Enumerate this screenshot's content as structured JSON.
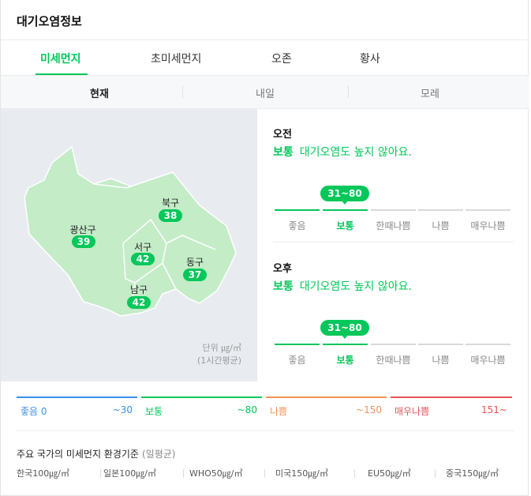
{
  "title": "대기오염정보",
  "tabs": [
    {
      "label": "미세먼지",
      "active": true
    },
    {
      "label": "초미세먼지",
      "active": false
    },
    {
      "label": "오존",
      "active": false
    },
    {
      "label": "황사",
      "active": false
    }
  ],
  "subtabs": [
    {
      "label": "현재",
      "active": true
    },
    {
      "label": "내일",
      "active": false
    },
    {
      "label": "모레",
      "active": false
    }
  ],
  "map": {
    "districts": [
      {
        "name": "광산구",
        "value": "39"
      },
      {
        "name": "북구",
        "value": "38"
      },
      {
        "name": "서구",
        "value": "42"
      },
      {
        "name": "동구",
        "value": "37"
      },
      {
        "name": "남구",
        "value": "42"
      }
    ],
    "unit_line1": "단위 ㎍/㎥",
    "unit_line2": "(1시간평균)",
    "colors": {
      "background": "#e8ecf1",
      "region_fill": "#c3ecc7",
      "region_stroke": "#ffffff",
      "pill": "#03c75a"
    }
  },
  "forecast": [
    {
      "period": "오전",
      "level": "보통",
      "message": "대기오염도 높지 않아요.",
      "range": "31~80",
      "active_index": 1,
      "scale": [
        "좋음",
        "보통",
        "한때나쁨",
        "나쁨",
        "매우나쁨"
      ]
    },
    {
      "period": "오후",
      "level": "보통",
      "message": "대기오염도 높지 않아요.",
      "range": "31~80",
      "active_index": 1,
      "scale": [
        "좋음",
        "보통",
        "한때나쁨",
        "나쁨",
        "매우나쁨"
      ]
    }
  ],
  "legend": [
    {
      "name": "좋음 0",
      "max": "~30",
      "color": "#3d8ee3"
    },
    {
      "name": "보통",
      "max": "~80",
      "color": "#03c75a"
    },
    {
      "name": "나쁨",
      "max": "~150",
      "color": "#f0935a"
    },
    {
      "name": "매우나쁨",
      "max": "151~",
      "color": "#e5535a"
    }
  ],
  "standards": {
    "title": "주요 국가의 미세먼지 환경기준",
    "subtitle": "(일평균)",
    "items": [
      "한국100㎍/㎥",
      "일본100㎍/㎥",
      "WHO50㎍/㎥",
      "미국150㎍/㎥",
      "EU50㎍/㎥",
      "중국150㎍/㎥"
    ]
  },
  "colors": {
    "accent": "#03c75a",
    "inactive_scale": "#d9d9d9"
  }
}
